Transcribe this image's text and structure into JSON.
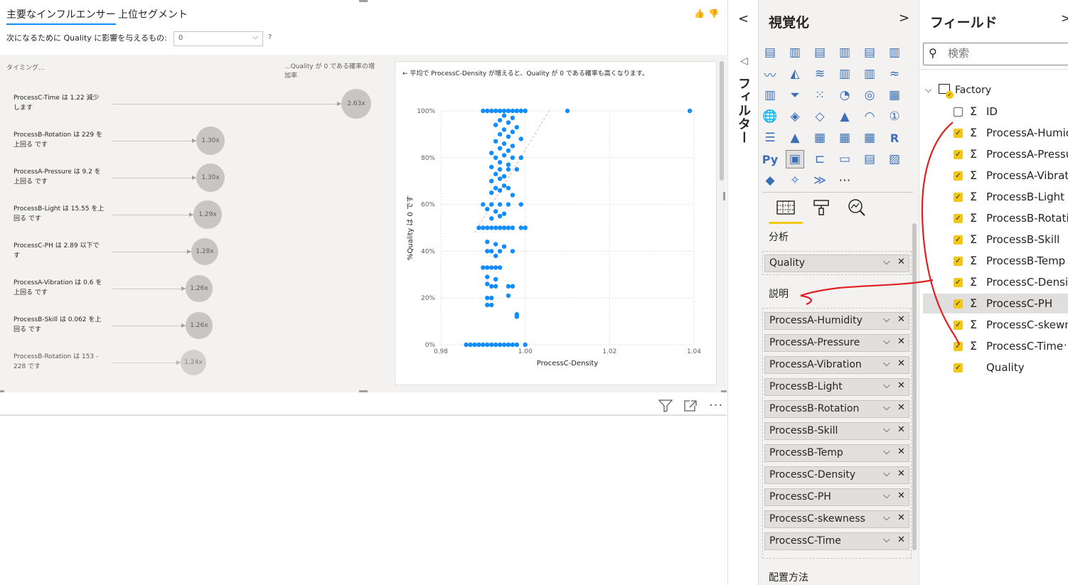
{
  "visual": {
    "tabs": [
      "主要なインフルエンサー",
      "上位セグメント"
    ],
    "question_label": "次になるために Quality に影響を与えるもの:",
    "question_value": "0",
    "question_help": "?",
    "like_icon": "👍",
    "dislike_icon": "👎",
    "column_left": "タイミング...",
    "column_right": "...Quality が 0 である確率の増加率",
    "influencers": [
      {
        "text": "ProcessC-Time は 1.22 減少します",
        "factor": "2.63x",
        "factor_value": 2.63
      },
      {
        "text": "ProcessB-Rotation は 229 を上回る です",
        "factor": "1.30x",
        "factor_value": 1.3
      },
      {
        "text": "ProcessA-Pressure は 9.2 を上回る です",
        "factor": "1.30x",
        "factor_value": 1.3
      },
      {
        "text": "ProcessB-Light は 15.55 を上回る です",
        "factor": "1.29x",
        "factor_value": 1.29
      },
      {
        "text": "ProcessC-PH は 2.89 以下です",
        "factor": "1.28x",
        "factor_value": 1.28
      },
      {
        "text": "ProcessA-Vibration は 0.6 を上回る です",
        "factor": "1.26x",
        "factor_value": 1.26
      },
      {
        "text": "ProcessB-Skill は 0.062 を上回る です",
        "factor": "1.26x",
        "factor_value": 1.26
      },
      {
        "text": "ProcessB-Rotation は 153 - 228 です",
        "factor": "1.24x",
        "factor_value": 1.24
      }
    ],
    "scatter_title": "← 平均で ProcessC-Density が増えると、Quality が 0 である確率も高くなります。",
    "bottom_icons": [
      "filter-icon",
      "focus-mode-icon",
      "more-options-icon"
    ]
  },
  "chart_data": {
    "type": "scatter",
    "title": "",
    "xlabel": "ProcessC-Density",
    "ylabel": "%Quality は 0 です",
    "xlim": [
      0.98,
      1.04
    ],
    "ylim": [
      0,
      100
    ],
    "x_ticks": [
      "0.98",
      "1.00",
      "1.02",
      "1.04"
    ],
    "y_ticks": [
      "0%",
      "20%",
      "40%",
      "60%",
      "80%",
      "100%"
    ],
    "grid": true,
    "series": [
      {
        "color": "#118dff",
        "points": [
          [
            0.99,
            100
          ],
          [
            0.992,
            100
          ],
          [
            0.994,
            100
          ],
          [
            0.996,
            100
          ],
          [
            0.998,
            100
          ],
          [
            1.0,
            100
          ],
          [
            0.991,
            100
          ],
          [
            0.993,
            100
          ],
          [
            0.995,
            100
          ],
          [
            0.997,
            100
          ],
          [
            0.999,
            100
          ],
          [
            1.01,
            100
          ],
          [
            1.039,
            100
          ],
          [
            0.995,
            98
          ],
          [
            0.997,
            97
          ],
          [
            0.994,
            96
          ],
          [
            0.996,
            95
          ],
          [
            0.993,
            94
          ],
          [
            0.998,
            93
          ],
          [
            0.995,
            92
          ],
          [
            0.997,
            91
          ],
          [
            0.994,
            90
          ],
          [
            0.996,
            89
          ],
          [
            0.999,
            88
          ],
          [
            0.993,
            87
          ],
          [
            0.995,
            86
          ],
          [
            0.997,
            85
          ],
          [
            0.994,
            84
          ],
          [
            0.996,
            83
          ],
          [
            0.992,
            82
          ],
          [
            0.995,
            81
          ],
          [
            0.993,
            80
          ],
          [
            0.997,
            80
          ],
          [
            0.999,
            80
          ],
          [
            0.994,
            78
          ],
          [
            0.996,
            77
          ],
          [
            0.992,
            76
          ],
          [
            0.994,
            75
          ],
          [
            0.996,
            75
          ],
          [
            0.998,
            75
          ],
          [
            0.993,
            73
          ],
          [
            0.995,
            72
          ],
          [
            0.994,
            71
          ],
          [
            0.992,
            70
          ],
          [
            0.995,
            68
          ],
          [
            0.993,
            67
          ],
          [
            0.996,
            67
          ],
          [
            0.994,
            66
          ],
          [
            0.992,
            65
          ],
          [
            0.997,
            64
          ],
          [
            0.99,
            60
          ],
          [
            0.992,
            60
          ],
          [
            0.994,
            60
          ],
          [
            0.996,
            60
          ],
          [
            0.999,
            60
          ],
          [
            0.991,
            58
          ],
          [
            0.993,
            57
          ],
          [
            0.995,
            56
          ],
          [
            0.994,
            55
          ],
          [
            0.992,
            54
          ],
          [
            0.989,
            50
          ],
          [
            0.99,
            50
          ],
          [
            0.991,
            50
          ],
          [
            0.992,
            50
          ],
          [
            0.993,
            50
          ],
          [
            0.994,
            50
          ],
          [
            0.995,
            50
          ],
          [
            0.996,
            50
          ],
          [
            0.997,
            50
          ],
          [
            0.999,
            50
          ],
          [
            1.0,
            50
          ],
          [
            0.991,
            44
          ],
          [
            0.993,
            43
          ],
          [
            0.995,
            42
          ],
          [
            0.991,
            40
          ],
          [
            0.992,
            40
          ],
          [
            0.994,
            40
          ],
          [
            0.997,
            40
          ],
          [
            0.993,
            38
          ],
          [
            0.99,
            33
          ],
          [
            0.991,
            33
          ],
          [
            0.992,
            33
          ],
          [
            0.993,
            33
          ],
          [
            0.994,
            33
          ],
          [
            0.991,
            29
          ],
          [
            0.993,
            28
          ],
          [
            0.991,
            26
          ],
          [
            0.992,
            25
          ],
          [
            0.993,
            25
          ],
          [
            0.996,
            25
          ],
          [
            0.997,
            25
          ],
          [
            0.991,
            20
          ],
          [
            0.992,
            20
          ],
          [
            0.991,
            17
          ],
          [
            0.992,
            17
          ],
          [
            0.996,
            21
          ],
          [
            0.998,
            13
          ],
          [
            0.998,
            12
          ],
          [
            0.986,
            0
          ],
          [
            0.988,
            0
          ],
          [
            0.99,
            0
          ],
          [
            0.992,
            0
          ],
          [
            0.994,
            0
          ],
          [
            0.996,
            0
          ],
          [
            0.998,
            0
          ],
          [
            0.987,
            0
          ],
          [
            0.989,
            0
          ],
          [
            0.991,
            0
          ],
          [
            0.993,
            0
          ],
          [
            0.995,
            0
          ],
          [
            0.997,
            0
          ],
          [
            1.0,
            0
          ]
        ]
      }
    ]
  },
  "filters": {
    "label": "フィルター",
    "collapse_icon": "chevron-left-icon"
  },
  "viz_pane": {
    "title": "視覚化",
    "icons": [
      "stacked-bar-icon",
      "stacked-column-icon",
      "clustered-bar-icon",
      "clustered-column-icon",
      "100pct-bar-icon",
      "100pct-column-icon",
      "line-chart-icon",
      "area-chart-icon",
      "stacked-area-icon",
      "line-column-icon",
      "line-clustered-icon",
      "ribbon-chart-icon",
      "waterfall-icon",
      "funnel-icon",
      "scatter-icon",
      "pie-icon",
      "donut-icon",
      "treemap-icon",
      "map-icon",
      "filled-map-icon",
      "shape-map-icon",
      "azure-map-icon",
      "gauge-icon",
      "card-icon",
      "multirow-card-icon",
      "kpi-icon",
      "slicer-icon",
      "table-icon",
      "matrix-icon",
      "r-visual-icon",
      "python-visual-icon",
      "key-influencers-icon",
      "decomposition-tree-icon",
      "qna-icon",
      "paginated-icon",
      "smart-narrative-icon",
      "powerapps-icon",
      "power-automate-icon",
      "ai-visual-icon",
      "more-icon"
    ],
    "pane_tabs": [
      "fields-tab-icon",
      "format-tab-icon",
      "analytics-tab-icon"
    ],
    "analyze_label": "分析",
    "analyze_field": "Quality",
    "explain_label": "説明",
    "explain_fields": [
      "ProcessA-Humidity",
      "ProcessA-Pressure",
      "ProcessA-Vibration",
      "ProcessB-Light",
      "ProcessB-Rotation",
      "ProcessB-Skill",
      "ProcessB-Temp",
      "ProcessC-Density",
      "ProcessC-PH",
      "ProcessC-skewness",
      "ProcessC-Time"
    ],
    "expand_by_label": "配置方法"
  },
  "fields_pane": {
    "title": "フィールド",
    "search_placeholder": "検索",
    "table": "Factory",
    "fields": [
      {
        "name": "ID",
        "sigma": true,
        "checked": false
      },
      {
        "name": "ProcessA-Humid...",
        "sigma": true,
        "checked": true
      },
      {
        "name": "ProcessA-Pressure",
        "sigma": true,
        "checked": true
      },
      {
        "name": "ProcessA-Vibrati...",
        "sigma": true,
        "checked": true
      },
      {
        "name": "ProcessB-Light",
        "sigma": true,
        "checked": true
      },
      {
        "name": "ProcessB-Rotation",
        "sigma": true,
        "checked": true
      },
      {
        "name": "ProcessB-Skill",
        "sigma": true,
        "checked": true
      },
      {
        "name": "ProcessB-Temp",
        "sigma": true,
        "checked": true
      },
      {
        "name": "ProcessC-Density",
        "sigma": true,
        "checked": true
      },
      {
        "name": "ProcessC-PH",
        "sigma": true,
        "checked": true
      },
      {
        "name": "ProcessC-skewn...",
        "sigma": true,
        "checked": true
      },
      {
        "name": "ProcessC-Time",
        "sigma": true,
        "checked": true
      },
      {
        "name": "Quality",
        "sigma": false,
        "checked": true
      }
    ],
    "highlighted_field": "ProcessC-PH"
  },
  "colors": {
    "accent": "#118dff",
    "check": "#f2c811",
    "annotation": "#e02020"
  }
}
